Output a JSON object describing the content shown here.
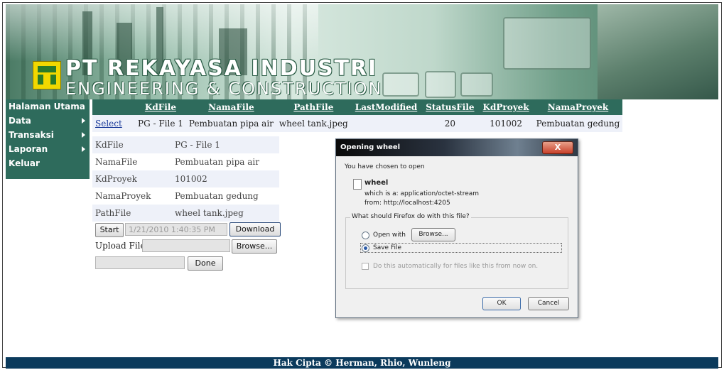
{
  "banner": {
    "company_line1": "PT REKAYASA INDUSTRI",
    "company_line2": "ENGINEERING & CONSTRUCTION"
  },
  "sidebar": {
    "items": [
      {
        "label": "Halaman Utama",
        "has_submenu": false
      },
      {
        "label": "Data",
        "has_submenu": true
      },
      {
        "label": "Transaksi",
        "has_submenu": true
      },
      {
        "label": "Laporan",
        "has_submenu": true
      },
      {
        "label": "Keluar",
        "has_submenu": false
      }
    ]
  },
  "grid": {
    "headers": [
      "KdFile",
      "NamaFile",
      "PathFile",
      "LastModified",
      "StatusFile",
      "KdProyek",
      "NamaProyek"
    ],
    "row": {
      "select_link": "Select",
      "kdfile": "PG - File 1",
      "namafile": "Pembuatan pipa air",
      "pathfile": "wheel tank.jpeg",
      "lastmodified": "",
      "statusfile": "20",
      "kdproyek": "101002",
      "namaproyek": "Pembuatan gedung"
    }
  },
  "details": {
    "rows": [
      {
        "label": "KdFile",
        "value": "PG - File 1"
      },
      {
        "label": "NamaFile",
        "value": "Pembuatan pipa air"
      },
      {
        "label": "KdProyek",
        "value": "101002"
      },
      {
        "label": "NamaProyek",
        "value": "Pembuatan gedung"
      },
      {
        "label": "PathFile",
        "value": "wheel tank.jpeg"
      }
    ]
  },
  "controls": {
    "start_label": "Start",
    "timestamp_value": "1/21/2010 1:40:35 PM",
    "download_label": "Download",
    "upload_label": "Upload File",
    "browse_label": "Browse...",
    "done_label": "Done"
  },
  "dialog": {
    "title": "Opening wheel",
    "close_label": "X",
    "intro": "You have chosen to open",
    "filename": "wheel",
    "which_is": "which is a:  application/octet-stream",
    "from": "from:  http://localhost:4205",
    "question": "What should Firefox do with this file?",
    "open_with_label": "Open with",
    "browse_label": "Browse...",
    "save_file_label": "Save File",
    "auto_label": "Do this automatically for files like this from now on.",
    "ok_label": "OK",
    "cancel_label": "Cancel",
    "selected_option": "save_file"
  },
  "footer": {
    "text": "Hak Cipta © Herman, Rhio, Wunleng"
  },
  "colors": {
    "menu_bg": "#2e6b5c",
    "footer_bg": "#0b3a5c",
    "row_alt": "#eef1f9"
  }
}
